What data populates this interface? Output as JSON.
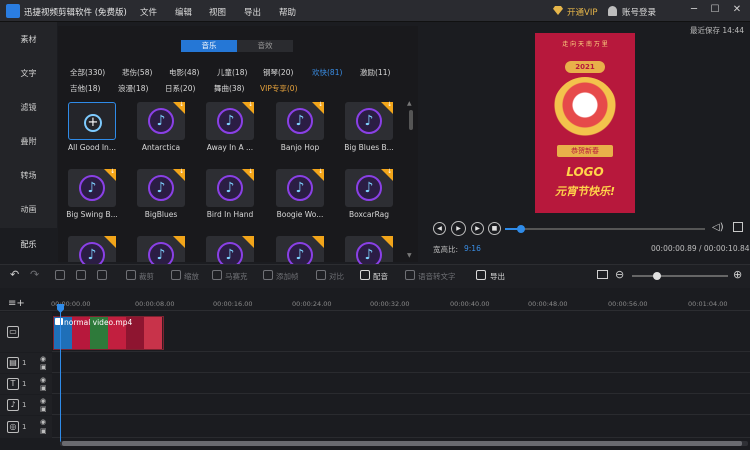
{
  "app": {
    "title": "迅捷视频剪辑软件 (免费版)"
  },
  "menu": [
    "文件",
    "编辑",
    "视图",
    "导出",
    "帮助"
  ],
  "account": {
    "vip": "开通VIP",
    "login": "账号登录"
  },
  "window_buttons": [
    "─",
    "☐",
    "✕"
  ],
  "sidebar": [
    {
      "label": "素材",
      "active": false
    },
    {
      "label": "文字",
      "active": false
    },
    {
      "label": "滤镜",
      "active": false
    },
    {
      "label": "叠附",
      "active": false
    },
    {
      "label": "转场",
      "active": false
    },
    {
      "label": "动画",
      "active": false
    },
    {
      "label": "配乐",
      "active": true
    }
  ],
  "library": {
    "tabs": [
      {
        "label": "音乐",
        "active": true
      },
      {
        "label": "音效",
        "active": false
      }
    ],
    "categories_row1": [
      {
        "label": "全部(330)"
      },
      {
        "label": "悲伤(58)"
      },
      {
        "label": "电影(48)"
      },
      {
        "label": "儿童(18)"
      },
      {
        "label": "钢琴(20)"
      },
      {
        "label": "欢快(81)",
        "active": true
      },
      {
        "label": "激励(11)"
      }
    ],
    "categories_row2": [
      {
        "label": "吉他(18)"
      },
      {
        "label": "浪漫(18)"
      },
      {
        "label": "日系(20)"
      },
      {
        "label": "舞曲(38)"
      },
      {
        "label": "VIP专享(0)",
        "vip": true
      }
    ],
    "tracks_row1": [
      "All Good In...",
      "Antarctica",
      "Away In A ...",
      "Banjo Hop",
      "Big Blues B..."
    ],
    "tracks_row2": [
      "Big Swing B...",
      "BigBlues",
      "Bird In Hand",
      "Boogie Wo...",
      "BoxcarRag"
    ]
  },
  "preview": {
    "autosave": "最近保存 14:44",
    "poster": {
      "top": "走 向 天 南 万 里",
      "year": "2021",
      "badge": "恭贺新春",
      "logo": "LOGO",
      "bottom": "元宵节快乐!"
    },
    "progress": 0.08,
    "ratio_label": "宽高比:",
    "ratio_value": "9:16",
    "time": "00:00:00.89 / 00:00:10.84"
  },
  "toolbar": {
    "tools": [
      {
        "label": "裁剪",
        "on": false
      },
      {
        "label": "缩放",
        "on": false
      },
      {
        "label": "马赛克",
        "on": false
      },
      {
        "label": "添加帧",
        "on": false
      },
      {
        "label": "对比",
        "on": false
      },
      {
        "label": "配音",
        "on": true
      },
      {
        "label": "语音转文字",
        "on": false
      },
      {
        "label": "导出",
        "on": true
      }
    ],
    "zoom_level": 0.26
  },
  "ruler": [
    "00:00:00.00",
    "00:00:08.00",
    "00:00:16.00",
    "00:00:24.00",
    "00:00:32.00",
    "00:00:40.00",
    "00:00:48.00",
    "00:00:56.00",
    "00:01:04.00"
  ],
  "tracks": [
    {
      "icon": "▭",
      "num": ""
    },
    {
      "icon": "▤",
      "num": "1"
    },
    {
      "icon": "T",
      "num": "1"
    },
    {
      "icon": "♪",
      "num": "1"
    },
    {
      "icon": "◎",
      "num": "1"
    }
  ],
  "clip": {
    "label": "normal video.mp4"
  },
  "colors": {
    "accent": "#2f8be8",
    "vip": "#e6a23c",
    "poster": "#b7183c"
  }
}
